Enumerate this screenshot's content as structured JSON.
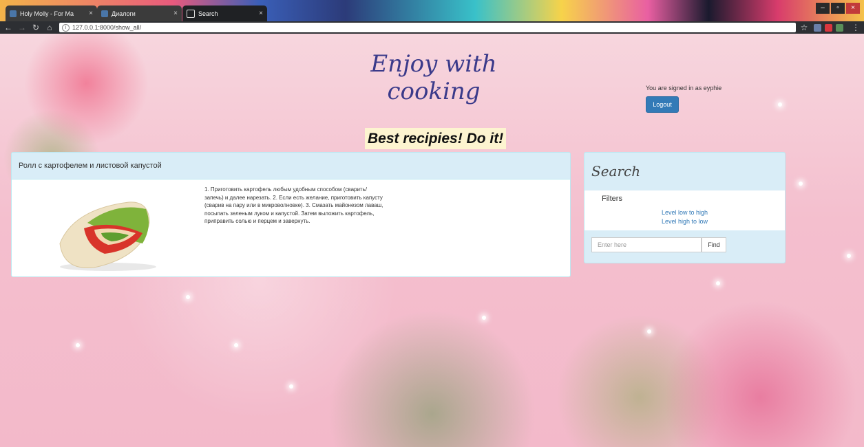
{
  "browser": {
    "tabs": [
      {
        "label": "Holy Molly - For Ma",
        "favicon_color": "#4a76a8",
        "extra": "◂"
      },
      {
        "label": "Диалоги",
        "favicon_color": "#4a76a8"
      },
      {
        "label": "Search",
        "favicon_color": "#ffffff"
      }
    ],
    "address": "127.0.0.1:8000/show_all/"
  },
  "header": {
    "site_title": "Enjoy with cooking",
    "signed_in_text": "You are signed in as eyphie",
    "logout_label": "Logout",
    "tagline": "Best recipies! Do it!"
  },
  "recipe": {
    "title": "Ролл с картофелем и листовой капустой",
    "description": "1. Приготовить картофель любым удобным способом (сварить/запечь) и далее нарезать. 2. Если есть желание, приготовить капусту (сварив на пару или в микроволновке). 3. Смазать майонезом лаваш, посыпать зеленым луком и капустой. Затем выложить картофель, приправить солью и перцем и завернуть."
  },
  "search": {
    "title": "Search",
    "filters_label": "Filters",
    "filter_links": [
      "Level low to high",
      "Level high to low"
    ],
    "input_placeholder": "Enter here",
    "find_label": "Find"
  },
  "colors": {
    "primary_button": "#337ab7",
    "panel_header": "#d9edf7",
    "link": "#337ab7"
  }
}
